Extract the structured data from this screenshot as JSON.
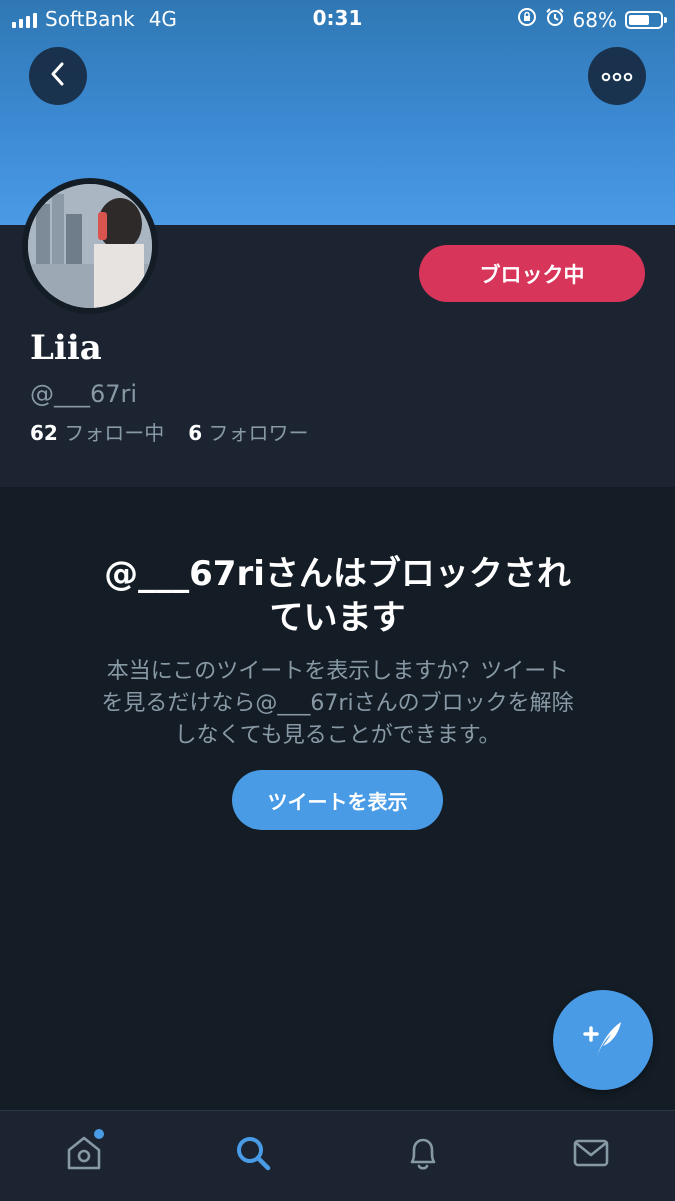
{
  "status_bar": {
    "carrier": "SoftBank",
    "network": "4G",
    "time": "0:31",
    "battery_percent": "68%",
    "battery_level": 0.68
  },
  "header": {
    "back_icon": "chevron-left-icon",
    "more_icon": "more-dots-icon"
  },
  "profile": {
    "name": "Liia",
    "handle": "@___67ri",
    "following_count": "62",
    "following_label": "フォロー中",
    "followers_count": "6",
    "followers_label": "フォロワー",
    "block_button_label": "ブロック中"
  },
  "blocked_notice": {
    "title_line1": "@___67riさんはブロックされ",
    "title_line2": "ています",
    "description_line1": "本当にこのツイートを表示しますか？ツイート",
    "description_line2": "を見るだけなら@___67riさんのブロックを解除",
    "description_line3": "しなくても見ることができます。",
    "show_tweets_label": "ツイートを表示"
  },
  "fab": {
    "icon": "compose-tweet-icon"
  },
  "tab_bar": {
    "items": [
      {
        "icon": "home-icon",
        "active": false,
        "has_badge": true
      },
      {
        "icon": "search-icon",
        "active": true,
        "has_badge": false
      },
      {
        "icon": "bell-icon",
        "active": false,
        "has_badge": false
      },
      {
        "icon": "mail-icon",
        "active": false,
        "has_badge": false
      }
    ]
  },
  "colors": {
    "background": "#141d26",
    "profile_panel": "#1b2430",
    "accent_blue": "#4a9be6",
    "block_red": "#d8355a",
    "secondary_text": "#8899a6"
  }
}
